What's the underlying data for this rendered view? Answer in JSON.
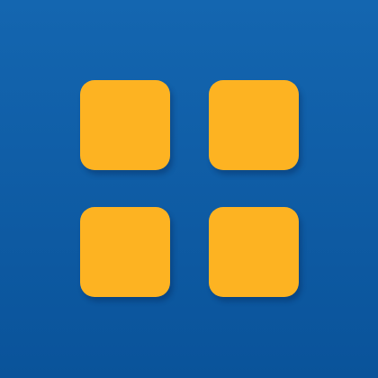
{
  "icon": {
    "name": "grid-apps-icon",
    "colors": {
      "background_top": "#1466B0",
      "background_bottom": "#0A539A",
      "tile": "#FDB322"
    },
    "tiles": [
      {
        "name": "tile-top-left"
      },
      {
        "name": "tile-top-right"
      },
      {
        "name": "tile-bottom-left"
      },
      {
        "name": "tile-bottom-right"
      }
    ]
  }
}
